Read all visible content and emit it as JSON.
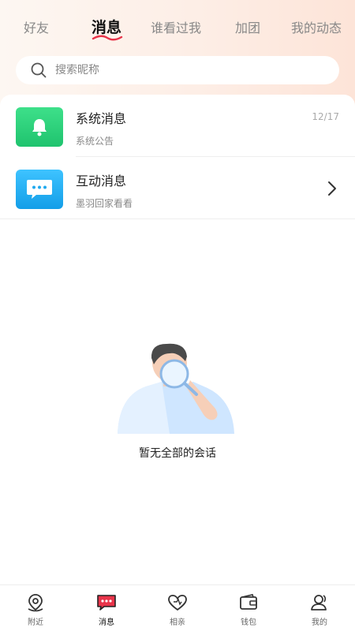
{
  "tabs": [
    {
      "label": "好友",
      "active": false
    },
    {
      "label": "消息",
      "active": true
    },
    {
      "label": "谁看过我",
      "active": false
    },
    {
      "label": "加团",
      "active": false
    },
    {
      "label": "我的动态",
      "active": false
    }
  ],
  "search": {
    "placeholder": "搜索昵称",
    "icon": "search-icon"
  },
  "messages": [
    {
      "title": "系统消息",
      "subtitle": "系统公告",
      "date": "12/17",
      "icon": "bell-icon",
      "color": "#2ed17a"
    },
    {
      "title": "互动消息",
      "subtitle": "墨羽回家看看",
      "icon": "chat-bubble-icon",
      "color": "#1fb0f5",
      "trailing": "chevron-right-icon"
    }
  ],
  "empty_state": {
    "text": "暂无全部的会话",
    "illustration": "person-magnifier-illustration"
  },
  "bottom_nav": [
    {
      "label": "附近",
      "icon": "location-pin-icon",
      "active": false
    },
    {
      "label": "消息",
      "icon": "message-icon",
      "active": true
    },
    {
      "label": "相亲",
      "icon": "heart-icon",
      "active": false
    },
    {
      "label": "钱包",
      "icon": "wallet-icon",
      "active": false
    },
    {
      "label": "我的",
      "icon": "profile-icon",
      "active": false
    }
  ],
  "colors": {
    "accent_red": "#e8344a",
    "header_bg": "#fdeee6"
  }
}
